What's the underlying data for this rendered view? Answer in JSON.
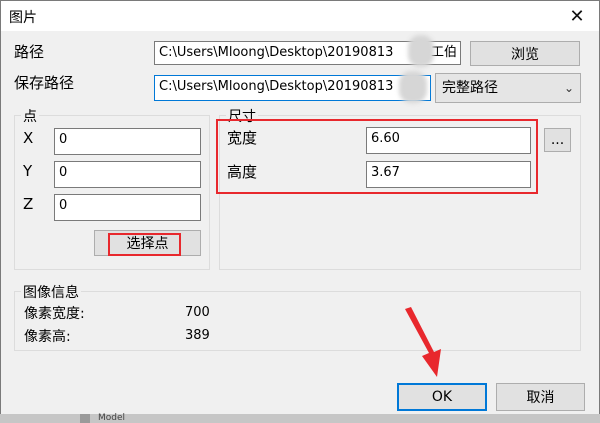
{
  "window": {
    "title": "图片",
    "close_glyph": "✕"
  },
  "path": {
    "label": "路径",
    "value": "C:\\Users\\Mloong\\Desktop\\20190813",
    "value_tail": "工伯",
    "browse_label": "浏览"
  },
  "save_path": {
    "label": "保存路径",
    "value": "C:\\Users\\Mloong\\Desktop\\20190813",
    "combo_value": "完整路径"
  },
  "point": {
    "group_title": "点",
    "x_label": "X",
    "x_value": "0",
    "y_label": "Y",
    "y_value": "0",
    "z_label": "Z",
    "z_value": "0",
    "select_label": "选择点"
  },
  "size": {
    "group_title": "尺寸",
    "width_label": "宽度",
    "width_value": "6.60",
    "height_label": "高度",
    "height_value": "3.67",
    "more_label": "..."
  },
  "image_info": {
    "group_title": "图像信息",
    "pixel_width_label": "像素宽度:",
    "pixel_width_value": "700",
    "pixel_height_label": "像素高:",
    "pixel_height_value": "389"
  },
  "buttons": {
    "ok_label": "OK",
    "cancel_label": "取消"
  },
  "background": {
    "strip_text": "Model"
  },
  "colors": {
    "annotation_red": "#e8282d",
    "accent_blue": "#0078d7"
  }
}
